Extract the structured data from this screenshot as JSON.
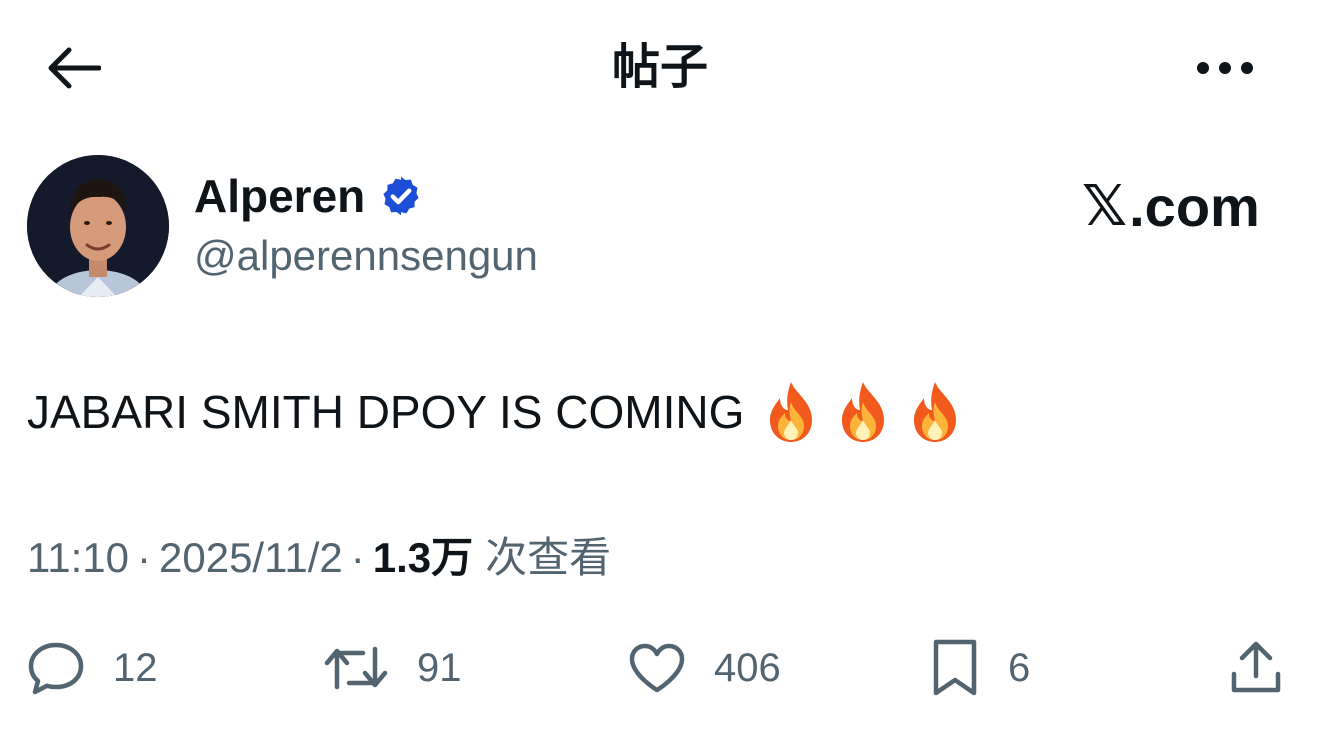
{
  "header": {
    "title": "帖子",
    "back_icon": "arrow-left-icon",
    "more_icon": "more-horizontal-icon"
  },
  "author": {
    "display_name": "Alperen",
    "handle": "@alperennsengun",
    "verified": true,
    "verified_color": "#1d4ed8"
  },
  "watermark": {
    "mark": "𝕏",
    "text": ".com"
  },
  "tweet": {
    "text": "JABARI SMITH DPOY IS COMING",
    "emojis": [
      "fire-emoji",
      "fire-emoji",
      "fire-emoji"
    ]
  },
  "meta": {
    "time": "11:10",
    "separator": "·",
    "date": "2025/11/2",
    "views_count": "1.3万",
    "views_label": "次查看"
  },
  "actions": {
    "reply": {
      "icon": "reply-icon",
      "count": "12"
    },
    "retweet": {
      "icon": "retweet-icon",
      "count": "91"
    },
    "like": {
      "icon": "heart-icon",
      "count": "406"
    },
    "bookmark": {
      "icon": "bookmark-icon",
      "count": "6"
    },
    "share": {
      "icon": "share-icon"
    }
  },
  "colors": {
    "text_primary": "#0f1419",
    "text_secondary": "#536471",
    "background": "#ffffff"
  }
}
